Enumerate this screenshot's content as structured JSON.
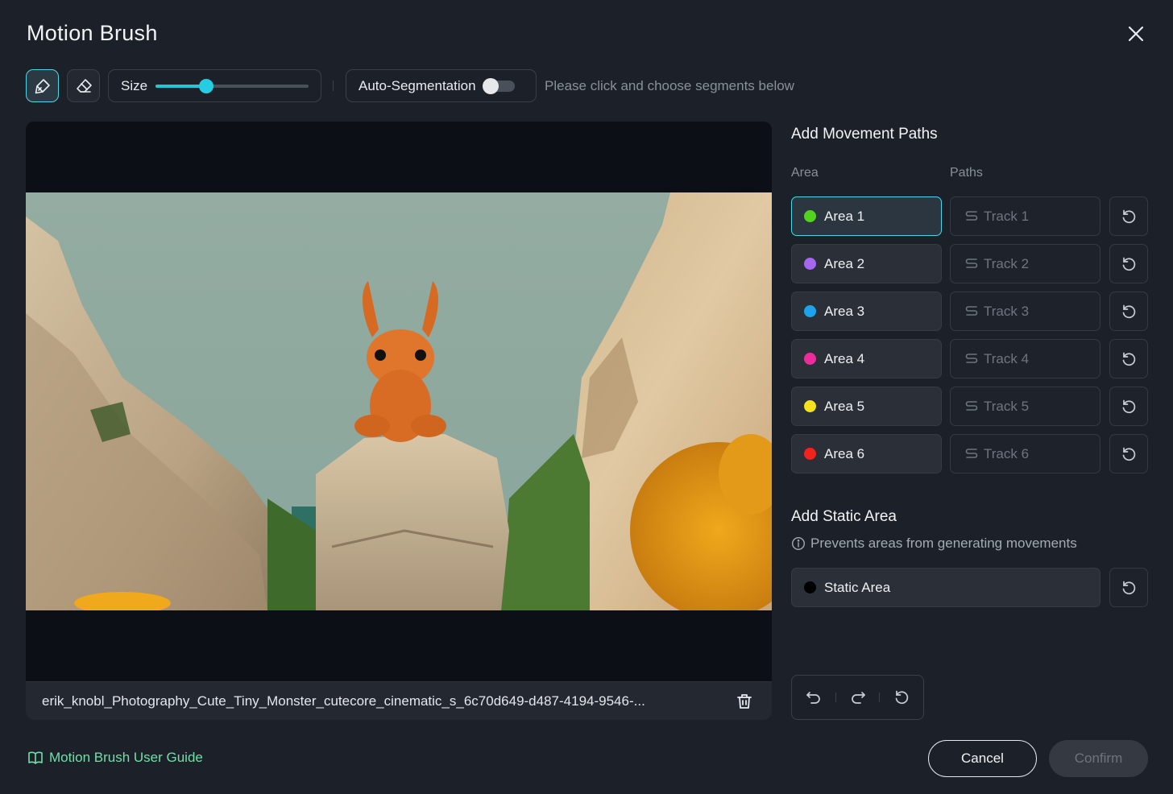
{
  "dialog": {
    "title": "Motion Brush",
    "close_icon": "close-icon"
  },
  "toolbar": {
    "brush_icon": "brush-icon",
    "eraser_icon": "eraser-icon",
    "size_label": "Size",
    "size_value_fraction": 0.33,
    "autoseg_label": "Auto-Segmentation",
    "autoseg_enabled": false,
    "hint": "Please click and choose segments below"
  },
  "canvas": {
    "file_name": "erik_knobl_Photography_Cute_Tiny_Monster_cutecore_cinematic_s_6c70d649-d487-4194-9546-...",
    "delete_icon": "trash-icon"
  },
  "movement": {
    "title": "Add Movement Paths",
    "area_header": "Area",
    "paths_header": "Paths",
    "rows": [
      {
        "area": "Area 1",
        "track": "Track 1",
        "color": "#52d41f",
        "selected": true
      },
      {
        "area": "Area 2",
        "track": "Track 2",
        "color": "#a566f0",
        "selected": false
      },
      {
        "area": "Area 3",
        "track": "Track 3",
        "color": "#1ca3ec",
        "selected": false
      },
      {
        "area": "Area 4",
        "track": "Track 4",
        "color": "#eb2d9c",
        "selected": false
      },
      {
        "area": "Area 5",
        "track": "Track 5",
        "color": "#f4e21c",
        "selected": false
      },
      {
        "area": "Area 6",
        "track": "Track 6",
        "color": "#f0241c",
        "selected": false
      }
    ]
  },
  "static": {
    "title": "Add Static Area",
    "note": "Prevents areas from generating movements",
    "area": "Static Area",
    "color": "#000000"
  },
  "footer": {
    "guide_link": "Motion Brush User Guide",
    "cancel": "Cancel",
    "confirm": "Confirm"
  },
  "colors": {
    "accent": "#4fd6e6",
    "slider": "#22c6dc",
    "link": "#6fe0a6"
  }
}
